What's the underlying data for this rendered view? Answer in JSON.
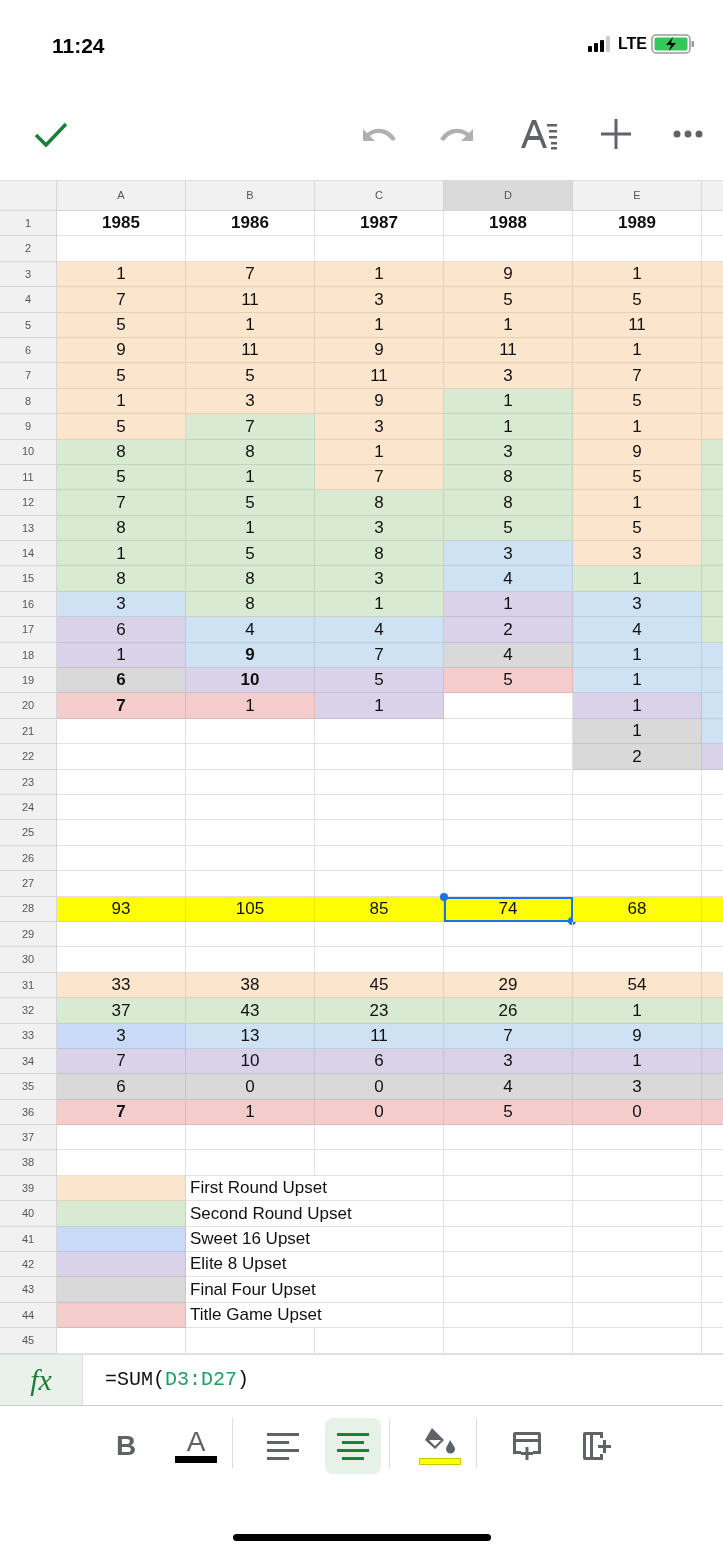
{
  "status_bar": {
    "time": "11:24",
    "network": "LTE"
  },
  "top_toolbar": {
    "undo_disabled": true,
    "redo_disabled": true
  },
  "column_headers": [
    {
      "label": "A",
      "selected": false
    },
    {
      "label": "B",
      "selected": false
    },
    {
      "label": "C",
      "selected": false
    },
    {
      "label": "D",
      "selected": true
    },
    {
      "label": "E",
      "selected": false
    }
  ],
  "rows": [
    {
      "number": "1",
      "cells": [
        {
          "text": "1985",
          "bold": true
        },
        {
          "text": "1986",
          "bold": true
        },
        {
          "text": "1987",
          "bold": true
        },
        {
          "text": "1988",
          "bold": true
        },
        {
          "text": "1989",
          "bold": true
        }
      ]
    },
    {
      "number": "2"
    },
    {
      "number": "3",
      "cells": [
        {
          "text": "1",
          "bold": false,
          "color": "#fce5cd"
        },
        {
          "text": "7",
          "bold": false,
          "color": "#fce5cd"
        },
        {
          "text": "1",
          "bold": false,
          "color": "#fce5cd"
        },
        {
          "text": "9",
          "bold": false,
          "color": "#fce5cd"
        },
        {
          "text": "1",
          "bold": false,
          "color": "#fce5cd"
        },
        {
          "color": "#fce5cd"
        }
      ]
    },
    {
      "number": "4",
      "cells": [
        {
          "text": "7",
          "bold": false,
          "color": "#fce5cd"
        },
        {
          "text": "11",
          "bold": false,
          "color": "#fce5cd"
        },
        {
          "text": "3",
          "bold": false,
          "color": "#fce5cd"
        },
        {
          "text": "5",
          "bold": false,
          "color": "#fce5cd"
        },
        {
          "text": "5",
          "bold": false,
          "color": "#fce5cd"
        },
        {
          "color": "#fce5cd"
        }
      ]
    },
    {
      "number": "5",
      "cells": [
        {
          "text": "5",
          "bold": false,
          "color": "#fce5cd"
        },
        {
          "text": "1",
          "bold": false,
          "color": "#fce5cd"
        },
        {
          "text": "1",
          "bold": false,
          "color": "#fce5cd"
        },
        {
          "text": "1",
          "bold": false,
          "color": "#fce5cd"
        },
        {
          "text": "11",
          "bold": false,
          "color": "#fce5cd"
        },
        {
          "color": "#fce5cd"
        }
      ]
    },
    {
      "number": "6",
      "cells": [
        {
          "text": "9",
          "bold": false,
          "color": "#fce5cd"
        },
        {
          "text": "11",
          "bold": false,
          "color": "#fce5cd"
        },
        {
          "text": "9",
          "bold": false,
          "color": "#fce5cd"
        },
        {
          "text": "11",
          "bold": false,
          "color": "#fce5cd"
        },
        {
          "text": "1",
          "bold": false,
          "color": "#fce5cd"
        },
        {
          "color": "#fce5cd"
        }
      ]
    },
    {
      "number": "7",
      "cells": [
        {
          "text": "5",
          "bold": false,
          "color": "#fce5cd"
        },
        {
          "text": "5",
          "bold": false,
          "color": "#fce5cd"
        },
        {
          "text": "11",
          "bold": false,
          "color": "#fce5cd"
        },
        {
          "text": "3",
          "bold": false,
          "color": "#fce5cd"
        },
        {
          "text": "7",
          "bold": false,
          "color": "#fce5cd"
        },
        {
          "color": "#fce5cd"
        }
      ]
    },
    {
      "number": "8",
      "cells": [
        {
          "text": "1",
          "bold": false,
          "color": "#fce5cd"
        },
        {
          "text": "3",
          "bold": false,
          "color": "#fce5cd"
        },
        {
          "text": "9",
          "bold": false,
          "color": "#fce5cd"
        },
        {
          "text": "1",
          "bold": false,
          "color": "#d9ead3"
        },
        {
          "text": "5",
          "bold": false,
          "color": "#fce5cd"
        },
        {
          "color": "#fce5cd"
        }
      ]
    },
    {
      "number": "9",
      "cells": [
        {
          "text": "5",
          "bold": false,
          "color": "#fce5cd"
        },
        {
          "text": "7",
          "bold": false,
          "color": "#d9ead3"
        },
        {
          "text": "3",
          "bold": false,
          "color": "#fce5cd"
        },
        {
          "text": "1",
          "bold": false,
          "color": "#d9ead3"
        },
        {
          "text": "1",
          "bold": false,
          "color": "#fce5cd"
        },
        {
          "color": "#fce5cd"
        }
      ]
    },
    {
      "number": "10",
      "cells": [
        {
          "text": "8",
          "bold": false,
          "color": "#d9ead3"
        },
        {
          "text": "8",
          "bold": false,
          "color": "#d9ead3"
        },
        {
          "text": "1",
          "bold": false,
          "color": "#fce5cd"
        },
        {
          "text": "3",
          "bold": false,
          "color": "#d9ead3"
        },
        {
          "text": "9",
          "bold": false,
          "color": "#fce5cd"
        },
        {
          "color": "#d9ead3"
        }
      ]
    },
    {
      "number": "11",
      "cells": [
        {
          "text": "5",
          "bold": false,
          "color": "#d9ead3"
        },
        {
          "text": "1",
          "bold": false,
          "color": "#d9ead3"
        },
        {
          "text": "7",
          "bold": false,
          "color": "#fce5cd"
        },
        {
          "text": "8",
          "bold": false,
          "color": "#d9ead3"
        },
        {
          "text": "5",
          "bold": false,
          "color": "#fce5cd"
        },
        {
          "color": "#d9ead3"
        }
      ]
    },
    {
      "number": "12",
      "cells": [
        {
          "text": "7",
          "bold": false,
          "color": "#d9ead3"
        },
        {
          "text": "5",
          "bold": false,
          "color": "#d9ead3"
        },
        {
          "text": "8",
          "bold": false,
          "color": "#d9ead3"
        },
        {
          "text": "8",
          "bold": false,
          "color": "#d9ead3"
        },
        {
          "text": "1",
          "bold": false,
          "color": "#fce5cd"
        },
        {
          "color": "#d9ead3"
        }
      ]
    },
    {
      "number": "13",
      "cells": [
        {
          "text": "8",
          "bold": false,
          "color": "#d9ead3"
        },
        {
          "text": "1",
          "bold": false,
          "color": "#d9ead3"
        },
        {
          "text": "3",
          "bold": false,
          "color": "#d9ead3"
        },
        {
          "text": "5",
          "bold": false,
          "color": "#d9ead3"
        },
        {
          "text": "5",
          "bold": false,
          "color": "#fce5cd"
        },
        {
          "color": "#d9ead3"
        }
      ]
    },
    {
      "number": "14",
      "cells": [
        {
          "text": "1",
          "bold": false,
          "color": "#d9ead3"
        },
        {
          "text": "5",
          "bold": false,
          "color": "#d9ead3"
        },
        {
          "text": "8",
          "bold": false,
          "color": "#d9ead3"
        },
        {
          "text": "3",
          "bold": false,
          "color": "#cfe2f3"
        },
        {
          "text": "3",
          "bold": false,
          "color": "#fce5cd"
        },
        {
          "color": "#d9ead3"
        }
      ]
    },
    {
      "number": "15",
      "cells": [
        {
          "text": "8",
          "bold": false,
          "color": "#d9ead3"
        },
        {
          "text": "8",
          "bold": false,
          "color": "#d9ead3"
        },
        {
          "text": "3",
          "bold": false,
          "color": "#d9ead3"
        },
        {
          "text": "4",
          "bold": false,
          "color": "#cfe2f3"
        },
        {
          "text": "1",
          "bold": false,
          "color": "#d9ead3"
        },
        {
          "color": "#d9ead3"
        }
      ]
    },
    {
      "number": "16",
      "cells": [
        {
          "text": "3",
          "bold": false,
          "color": "#cfe2f3"
        },
        {
          "text": "8",
          "bold": false,
          "color": "#d9ead3"
        },
        {
          "text": "1",
          "bold": false,
          "color": "#d9ead3"
        },
        {
          "text": "1",
          "bold": false,
          "color": "#d9d2e9"
        },
        {
          "text": "3",
          "bold": false,
          "color": "#cfe2f3"
        },
        {
          "color": "#d9ead3"
        }
      ]
    },
    {
      "number": "17",
      "cells": [
        {
          "text": "6",
          "bold": false,
          "color": "#d9d2e9"
        },
        {
          "text": "4",
          "bold": false,
          "color": "#cfe2f3"
        },
        {
          "text": "4",
          "bold": false,
          "color": "#cfe2f3"
        },
        {
          "text": "2",
          "bold": false,
          "color": "#d9d2e9"
        },
        {
          "text": "4",
          "bold": false,
          "color": "#cfe2f3"
        },
        {
          "color": "#d9ead3"
        }
      ]
    },
    {
      "number": "18",
      "cells": [
        {
          "text": "1",
          "bold": false,
          "color": "#d9d2e9"
        },
        {
          "text": "9",
          "bold": true,
          "color": "#cfe2f3"
        },
        {
          "text": "7",
          "bold": false,
          "color": "#cfe2f3"
        },
        {
          "text": "4",
          "bold": false,
          "color": "#d9d9d9"
        },
        {
          "text": "1",
          "bold": false,
          "color": "#cfe2f3"
        },
        {
          "color": "#cfe2f3"
        }
      ]
    },
    {
      "number": "19",
      "cells": [
        {
          "text": "6",
          "bold": true,
          "color": "#d9d9d9"
        },
        {
          "text": "10",
          "bold": true,
          "color": "#d9d2e9"
        },
        {
          "text": "5",
          "bold": false,
          "color": "#d9d2e9"
        },
        {
          "text": "5",
          "bold": false,
          "color": "#f4cccc"
        },
        {
          "text": "1",
          "bold": false,
          "color": "#cfe2f3"
        },
        {
          "color": "#cfe2f3"
        }
      ]
    },
    {
      "number": "20",
      "cells": [
        {
          "text": "7",
          "bold": true,
          "color": "#f4cccc"
        },
        {
          "text": "1",
          "bold": false,
          "color": "#f4cccc"
        },
        {
          "text": "1",
          "bold": false,
          "color": "#d9d2e9"
        },
        {},
        {
          "text": "1",
          "bold": false,
          "color": "#d9d2e9"
        },
        {
          "color": "#cfe2f3"
        }
      ]
    },
    {
      "number": "21",
      "cells": [
        {},
        {},
        {},
        {},
        {
          "text": "1",
          "bold": false,
          "color": "#d9d9d9"
        },
        {
          "color": "#cfe2f3"
        }
      ]
    },
    {
      "number": "22",
      "cells": [
        {},
        {},
        {},
        {},
        {
          "text": "2",
          "bold": false,
          "color": "#d9d9d9"
        },
        {
          "color": "#d9d2e9"
        }
      ]
    },
    {
      "number": "23"
    },
    {
      "number": "24"
    },
    {
      "number": "25"
    },
    {
      "number": "26"
    },
    {
      "number": "27"
    },
    {
      "number": "28",
      "cells": [
        {
          "text": "93",
          "bold": false,
          "color": "#ffff00"
        },
        {
          "text": "105",
          "bold": false,
          "color": "#ffff00"
        },
        {
          "text": "85",
          "bold": false,
          "color": "#ffff00"
        },
        {
          "text": "74",
          "bold": false,
          "color": "#ffff00",
          "selected": true
        },
        {
          "text": "68",
          "bold": false,
          "color": "#ffff00"
        },
        {
          "color": "#ffff00"
        }
      ]
    },
    {
      "number": "29"
    },
    {
      "number": "30"
    },
    {
      "number": "31",
      "cells": [
        {
          "text": "33",
          "bold": false,
          "color": "#fce5cd"
        },
        {
          "text": "38",
          "bold": false,
          "color": "#fce5cd"
        },
        {
          "text": "45",
          "bold": false,
          "color": "#fce5cd"
        },
        {
          "text": "29",
          "bold": false,
          "color": "#fce5cd"
        },
        {
          "text": "54",
          "bold": false,
          "color": "#fce5cd"
        },
        {
          "color": "#fce5cd"
        }
      ]
    },
    {
      "number": "32",
      "cells": [
        {
          "text": "37",
          "bold": false,
          "color": "#d9ead3"
        },
        {
          "text": "43",
          "bold": false,
          "color": "#d9ead3"
        },
        {
          "text": "23",
          "bold": false,
          "color": "#d9ead3"
        },
        {
          "text": "26",
          "bold": false,
          "color": "#d9ead3"
        },
        {
          "text": "1",
          "bold": false,
          "color": "#d9ead3"
        },
        {
          "color": "#d9ead3"
        }
      ]
    },
    {
      "number": "33",
      "cells": [
        {
          "text": "3",
          "bold": false,
          "color": "#c9daf8"
        },
        {
          "text": "13",
          "bold": false,
          "color": "#cfe2f3"
        },
        {
          "text": "11",
          "bold": false,
          "color": "#cfe2f3"
        },
        {
          "text": "7",
          "bold": false,
          "color": "#cfe2f3"
        },
        {
          "text": "9",
          "bold": false,
          "color": "#cfe2f3"
        },
        {
          "color": "#cfe2f3"
        }
      ]
    },
    {
      "number": "34",
      "cells": [
        {
          "text": "7",
          "bold": false,
          "color": "#d9d2e9"
        },
        {
          "text": "10",
          "bold": false,
          "color": "#d9d2e9"
        },
        {
          "text": "6",
          "bold": false,
          "color": "#d9d2e9"
        },
        {
          "text": "3",
          "bold": false,
          "color": "#d9d2e9"
        },
        {
          "text": "1",
          "bold": false,
          "color": "#d9d2e9"
        },
        {
          "color": "#d9d2e9"
        }
      ]
    },
    {
      "number": "35",
      "cells": [
        {
          "text": "6",
          "bold": false,
          "color": "#d9d9d9"
        },
        {
          "text": "0",
          "bold": false,
          "color": "#d9d9d9"
        },
        {
          "text": "0",
          "bold": false,
          "color": "#d9d9d9"
        },
        {
          "text": "4",
          "bold": false,
          "color": "#d9d9d9"
        },
        {
          "text": "3",
          "bold": false,
          "color": "#d9d9d9"
        },
        {
          "color": "#d9d9d9"
        }
      ]
    },
    {
      "number": "36",
      "cells": [
        {
          "text": "7",
          "bold": true,
          "color": "#f4cccc"
        },
        {
          "text": "1",
          "bold": false,
          "color": "#f4cccc"
        },
        {
          "text": "0",
          "bold": false,
          "color": "#f4cccc"
        },
        {
          "text": "5",
          "bold": false,
          "color": "#f4cccc"
        },
        {
          "text": "0",
          "bold": false,
          "color": "#f4cccc"
        },
        {
          "color": "#f4cccc"
        }
      ]
    },
    {
      "number": "37"
    },
    {
      "number": "38"
    },
    {
      "number": "39",
      "kind": "legend",
      "cells": [
        {
          "color": "#fce5cd"
        },
        {
          "text": "First Round Upset",
          "bold": false
        }
      ]
    },
    {
      "number": "40",
      "kind": "legend",
      "cells": [
        {
          "color": "#d9ead3"
        },
        {
          "text": "Second Round Upset",
          "bold": false
        }
      ]
    },
    {
      "number": "41",
      "kind": "legend",
      "cells": [
        {
          "color": "#c9daf8"
        },
        {
          "text": "Sweet 16 Upset",
          "bold": false
        }
      ]
    },
    {
      "number": "42",
      "kind": "legend",
      "cells": [
        {
          "color": "#d9d2e9"
        },
        {
          "text": "Elite 8 Upset",
          "bold": false
        }
      ]
    },
    {
      "number": "43",
      "kind": "legend",
      "cells": [
        {
          "color": "#d9d9d9"
        },
        {
          "text": "Final Four Upset",
          "bold": false
        }
      ]
    },
    {
      "number": "44",
      "kind": "legend",
      "cells": [
        {
          "color": "#f4cccc"
        },
        {
          "text": "Title Game Upset",
          "bold": false
        }
      ]
    },
    {
      "number": "45"
    }
  ],
  "formula_bar": {
    "label": "fx",
    "formula_prefix": "=SUM(",
    "formula_range": "D3:D27",
    "formula_suffix": ")"
  },
  "format_toolbar": [
    {
      "kind": "bold",
      "label": "B",
      "selected": false
    },
    {
      "kind": "text-color",
      "label": "A",
      "selected": false,
      "color": "#000000"
    },
    {
      "kind": "align-left",
      "selected": false
    },
    {
      "kind": "align-center",
      "selected": true
    },
    {
      "kind": "fill-color",
      "selected": false,
      "color": "#ffff00"
    },
    {
      "kind": "insert-row",
      "selected": false
    },
    {
      "kind": "insert-column",
      "selected": false
    }
  ]
}
